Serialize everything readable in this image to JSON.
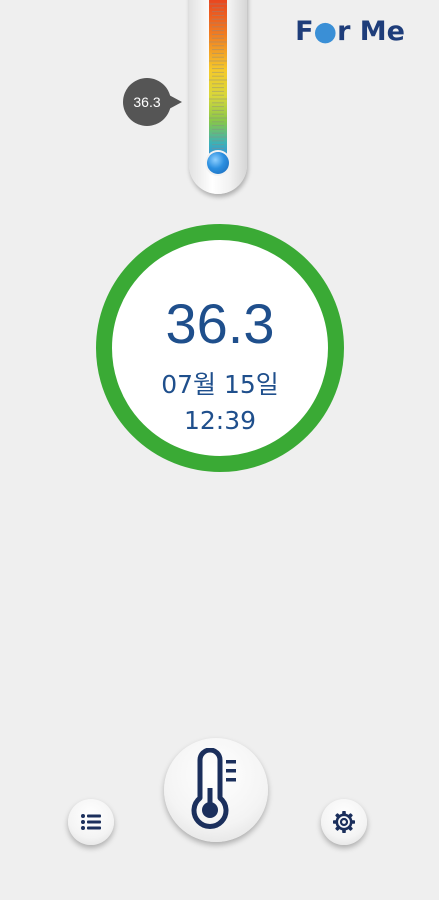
{
  "brand": {
    "logo_prefix": "F",
    "logo_suffix": "r Me",
    "accent_color": "#1e3d7a"
  },
  "gauge": {
    "bubble_value": "36.3",
    "level": 36.3
  },
  "reading": {
    "temperature": "36.3",
    "date": "07월 15일",
    "time": "12:39",
    "ring_color": "#3aaa35",
    "text_color": "#1f4f8c"
  },
  "controls": {
    "list_icon": "list-icon",
    "measure_icon": "thermometer-icon",
    "settings_icon": "gear-icon"
  }
}
